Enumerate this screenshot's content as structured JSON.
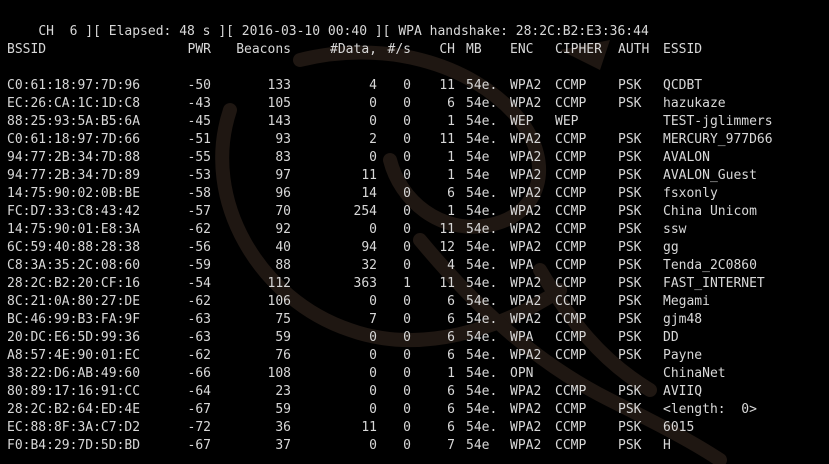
{
  "status": {
    "text": "CH  6 ][ Elapsed: 48 s ][ 2016-03-10 00:40 ][ WPA handshake: 28:2C:B2:E3:36:44"
  },
  "header": {
    "bssid": "BSSID",
    "pwr": "PWR",
    "beacons": "Beacons",
    "data": "#Data,",
    "rate": "#/s",
    "ch": "CH",
    "mb": "MB",
    "enc": "ENC",
    "cipher": "CIPHER",
    "auth": "AUTH",
    "essid": "ESSID"
  },
  "rows": [
    {
      "bssid": "C0:61:18:97:7D:96",
      "pwr": "-50",
      "beacons": "133",
      "data": "4",
      "rate": "0",
      "ch": "11",
      "mb": "54e.",
      "enc": "WPA2",
      "cipher": "CCMP",
      "auth": "PSK",
      "essid": "QCDBT"
    },
    {
      "bssid": "EC:26:CA:1C:1D:C8",
      "pwr": "-43",
      "beacons": "105",
      "data": "0",
      "rate": "0",
      "ch": "6",
      "mb": "54e.",
      "enc": "WPA2",
      "cipher": "CCMP",
      "auth": "PSK",
      "essid": "hazukaze"
    },
    {
      "bssid": "88:25:93:5A:B5:6A",
      "pwr": "-45",
      "beacons": "143",
      "data": "0",
      "rate": "0",
      "ch": "1",
      "mb": "54e.",
      "enc": "WEP",
      "cipher": "WEP",
      "auth": "",
      "essid": "TEST-jglimmers"
    },
    {
      "bssid": "C0:61:18:97:7D:66",
      "pwr": "-51",
      "beacons": "93",
      "data": "2",
      "rate": "0",
      "ch": "11",
      "mb": "54e.",
      "enc": "WPA2",
      "cipher": "CCMP",
      "auth": "PSK",
      "essid": "MERCURY_977D66"
    },
    {
      "bssid": "94:77:2B:34:7D:88",
      "pwr": "-55",
      "beacons": "83",
      "data": "0",
      "rate": "0",
      "ch": "1",
      "mb": "54e",
      "enc": "WPA2",
      "cipher": "CCMP",
      "auth": "PSK",
      "essid": "AVALON"
    },
    {
      "bssid": "94:77:2B:34:7D:89",
      "pwr": "-53",
      "beacons": "97",
      "data": "11",
      "rate": "0",
      "ch": "1",
      "mb": "54e",
      "enc": "WPA2",
      "cipher": "CCMP",
      "auth": "PSK",
      "essid": "AVALON_Guest"
    },
    {
      "bssid": "14:75:90:02:0B:BE",
      "pwr": "-58",
      "beacons": "96",
      "data": "14",
      "rate": "0",
      "ch": "6",
      "mb": "54e.",
      "enc": "WPA2",
      "cipher": "CCMP",
      "auth": "PSK",
      "essid": "fsxonly"
    },
    {
      "bssid": "FC:D7:33:C8:43:42",
      "pwr": "-57",
      "beacons": "70",
      "data": "254",
      "rate": "0",
      "ch": "1",
      "mb": "54e.",
      "enc": "WPA2",
      "cipher": "CCMP",
      "auth": "PSK",
      "essid": "China Unicom"
    },
    {
      "bssid": "14:75:90:01:E8:3A",
      "pwr": "-62",
      "beacons": "92",
      "data": "0",
      "rate": "0",
      "ch": "11",
      "mb": "54e.",
      "enc": "WPA2",
      "cipher": "CCMP",
      "auth": "PSK",
      "essid": "ssw"
    },
    {
      "bssid": "6C:59:40:88:28:38",
      "pwr": "-56",
      "beacons": "40",
      "data": "94",
      "rate": "0",
      "ch": "12",
      "mb": "54e.",
      "enc": "WPA2",
      "cipher": "CCMP",
      "auth": "PSK",
      "essid": "gg"
    },
    {
      "bssid": "C8:3A:35:2C:08:60",
      "pwr": "-59",
      "beacons": "88",
      "data": "32",
      "rate": "0",
      "ch": "4",
      "mb": "54e.",
      "enc": "WPA",
      "cipher": "CCMP",
      "auth": "PSK",
      "essid": "Tenda_2C0860"
    },
    {
      "bssid": "28:2C:B2:20:CF:16",
      "pwr": "-54",
      "beacons": "112",
      "data": "363",
      "rate": "1",
      "ch": "11",
      "mb": "54e.",
      "enc": "WPA2",
      "cipher": "CCMP",
      "auth": "PSK",
      "essid": "FAST_INTERNET"
    },
    {
      "bssid": "8C:21:0A:80:27:DE",
      "pwr": "-62",
      "beacons": "106",
      "data": "0",
      "rate": "0",
      "ch": "6",
      "mb": "54e.",
      "enc": "WPA2",
      "cipher": "CCMP",
      "auth": "PSK",
      "essid": "Megami"
    },
    {
      "bssid": "BC:46:99:B3:FA:9F",
      "pwr": "-63",
      "beacons": "75",
      "data": "7",
      "rate": "0",
      "ch": "6",
      "mb": "54e.",
      "enc": "WPA2",
      "cipher": "CCMP",
      "auth": "PSK",
      "essid": "gjm48"
    },
    {
      "bssid": "20:DC:E6:5D:99:36",
      "pwr": "-63",
      "beacons": "59",
      "data": "0",
      "rate": "0",
      "ch": "6",
      "mb": "54e.",
      "enc": "WPA",
      "cipher": "CCMP",
      "auth": "PSK",
      "essid": "DD"
    },
    {
      "bssid": "A8:57:4E:90:01:EC",
      "pwr": "-62",
      "beacons": "76",
      "data": "0",
      "rate": "0",
      "ch": "6",
      "mb": "54e.",
      "enc": "WPA2",
      "cipher": "CCMP",
      "auth": "PSK",
      "essid": "Payne"
    },
    {
      "bssid": "38:22:D6:AB:49:60",
      "pwr": "-66",
      "beacons": "108",
      "data": "0",
      "rate": "0",
      "ch": "1",
      "mb": "54e.",
      "enc": "OPN",
      "cipher": "",
      "auth": "",
      "essid": "ChinaNet"
    },
    {
      "bssid": "80:89:17:16:91:CC",
      "pwr": "-64",
      "beacons": "23",
      "data": "0",
      "rate": "0",
      "ch": "6",
      "mb": "54e.",
      "enc": "WPA2",
      "cipher": "CCMP",
      "auth": "PSK",
      "essid": "AVIIQ"
    },
    {
      "bssid": "28:2C:B2:64:ED:4E",
      "pwr": "-67",
      "beacons": "59",
      "data": "0",
      "rate": "0",
      "ch": "6",
      "mb": "54e.",
      "enc": "WPA2",
      "cipher": "CCMP",
      "auth": "PSK",
      "essid": "<length:  0>"
    },
    {
      "bssid": "EC:88:8F:3A:C7:D2",
      "pwr": "-72",
      "beacons": "36",
      "data": "11",
      "rate": "0",
      "ch": "6",
      "mb": "54e.",
      "enc": "WPA2",
      "cipher": "CCMP",
      "auth": "PSK",
      "essid": "6015"
    },
    {
      "bssid": "F0:B4:29:7D:5D:BD",
      "pwr": "-67",
      "beacons": "37",
      "data": "0",
      "rate": "0",
      "ch": "7",
      "mb": "54e",
      "enc": "WPA2",
      "cipher": "CCMP",
      "auth": "PSK",
      "essid": "H"
    }
  ],
  "colors": {
    "background": "#000000",
    "text": "#d8d8d8",
    "dragon": "#1c1410"
  }
}
